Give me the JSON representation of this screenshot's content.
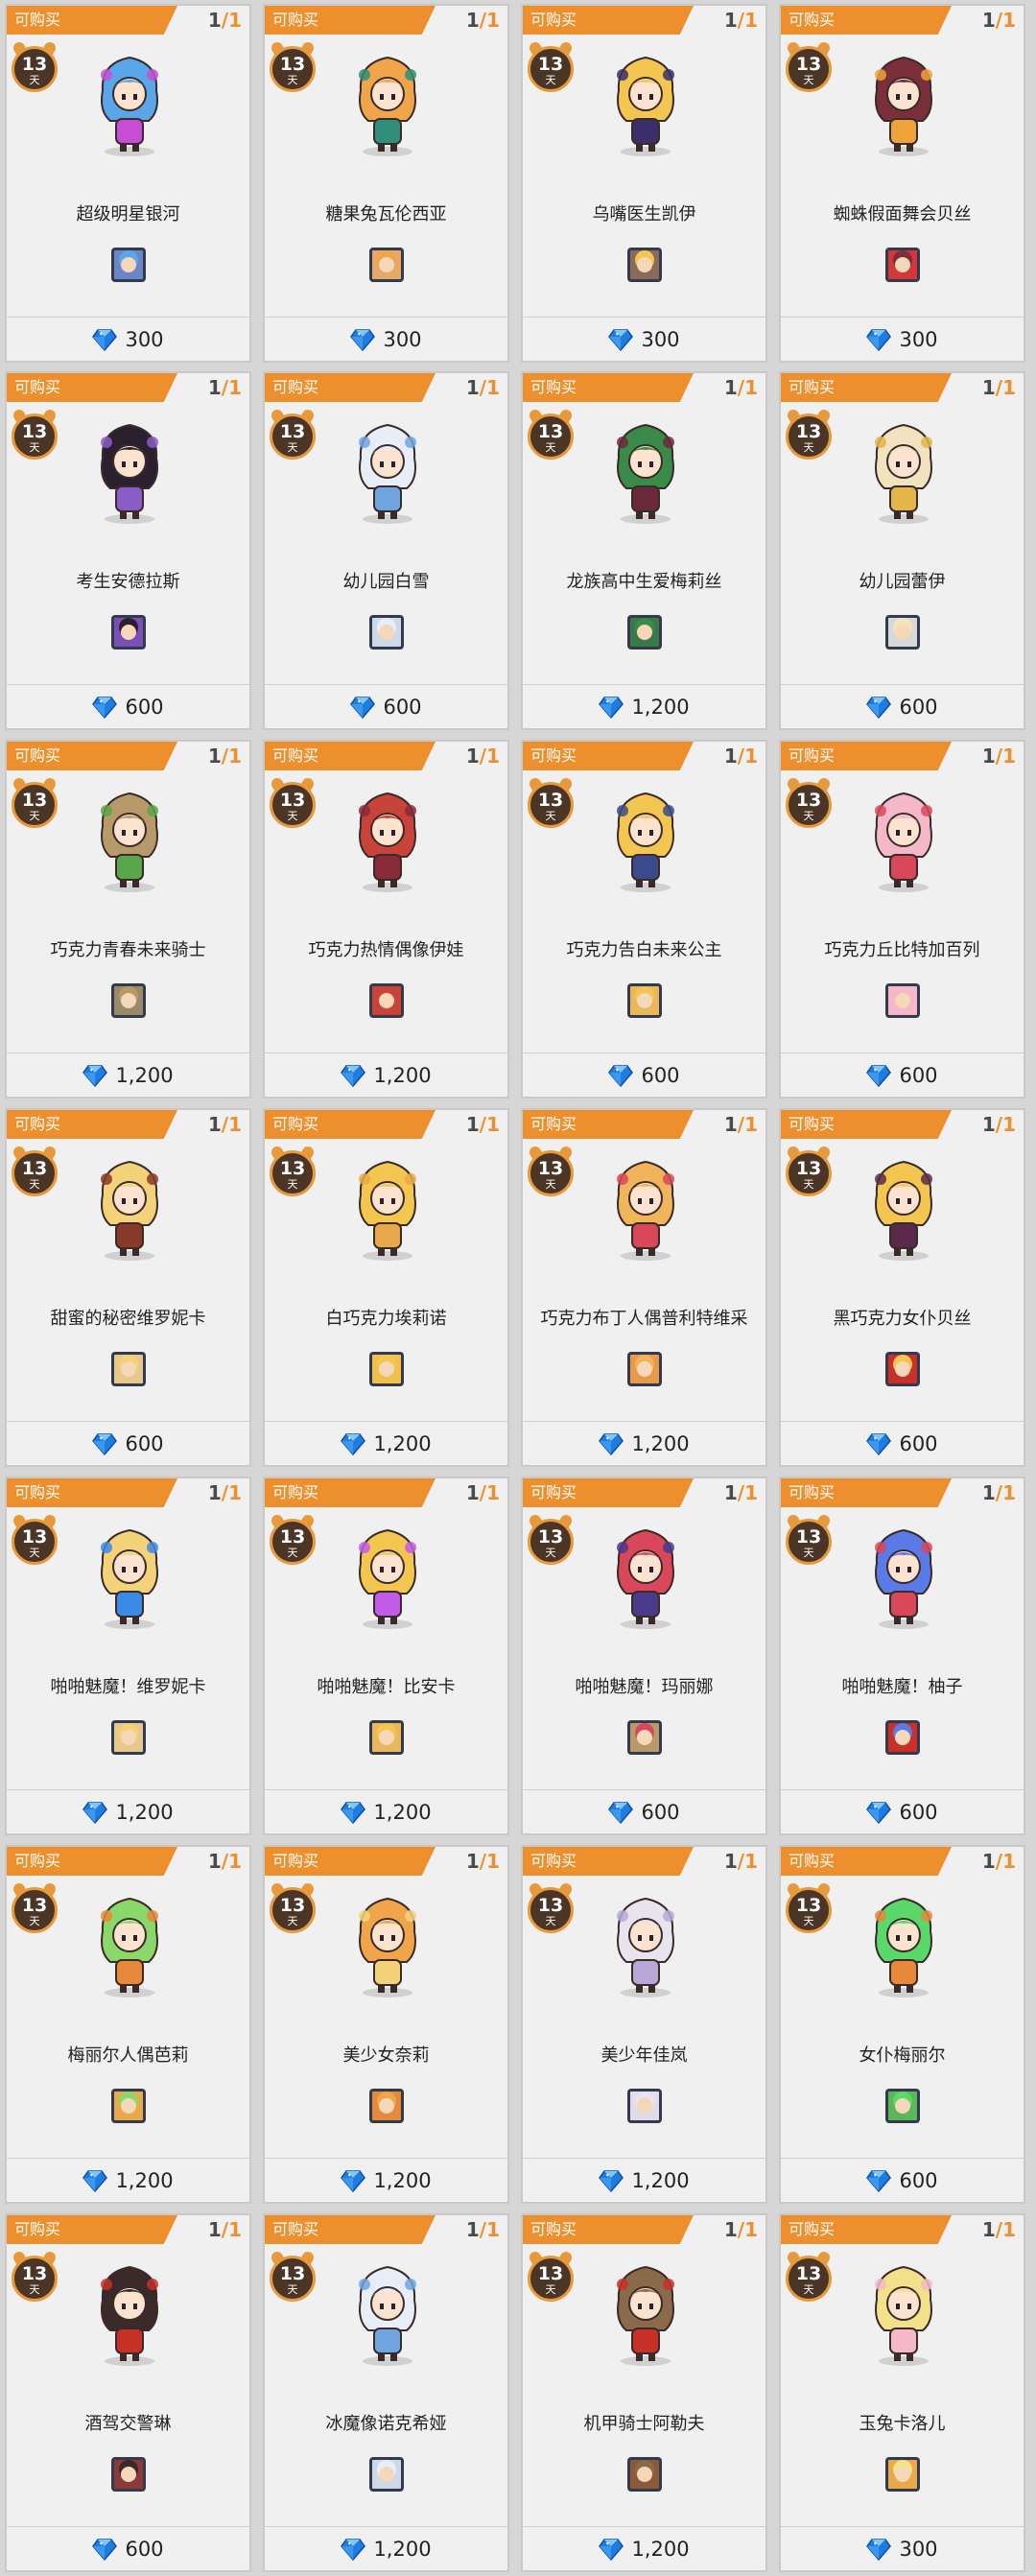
{
  "card_labels": {
    "status": "可购买",
    "count_current": "1",
    "count_slash": "/",
    "count_max": "1",
    "days": "13",
    "days_unit": "天"
  },
  "items": [
    {
      "name": "超级明星银河",
      "price": "300",
      "hair": "#5aa6e8",
      "accent": "#c74dd6",
      "thumb_bg": "#6b85c9"
    },
    {
      "name": "糖果兔瓦伦西亚",
      "price": "300",
      "hair": "#f0a54a",
      "accent": "#2f8f7a",
      "thumb_bg": "#e8a968"
    },
    {
      "name": "乌嘴医生凯伊",
      "price": "300",
      "hair": "#f3c64f",
      "accent": "#3a2f6a",
      "thumb_bg": "#8a6a5a"
    },
    {
      "name": "蜘蛛假面舞会贝丝",
      "price": "300",
      "hair": "#7a2f3a",
      "accent": "#f0a23a",
      "thumb_bg": "#d4363a"
    },
    {
      "name": "考生安德拉斯",
      "price": "600",
      "hair": "#2a2030",
      "accent": "#8a5cc7",
      "thumb_bg": "#7a4fb8"
    },
    {
      "name": "幼儿园白雪",
      "price": "600",
      "hair": "#e8eef8",
      "accent": "#6fa4de",
      "thumb_bg": "#cfd8e6"
    },
    {
      "name": "龙族高中生爱梅莉丝",
      "price": "1,200",
      "hair": "#3a8a4a",
      "accent": "#6a2a3a",
      "thumb_bg": "#3a7a4a"
    },
    {
      "name": "幼儿园蕾伊",
      "price": "600",
      "hair": "#f2e3c0",
      "accent": "#e3b54a",
      "thumb_bg": "#d8d8d8"
    },
    {
      "name": "巧克力青春未来骑士",
      "price": "1,200",
      "hair": "#b89a6a",
      "accent": "#5aa64a",
      "thumb_bg": "#9a8a6a"
    },
    {
      "name": "巧克力热情偶像伊娃",
      "price": "1,200",
      "hair": "#c8433a",
      "accent": "#8a2a3a",
      "thumb_bg": "#c8433a"
    },
    {
      "name": "巧克力告白未来公主",
      "price": "600",
      "hair": "#f3c64f",
      "accent": "#3a4a8a",
      "thumb_bg": "#e8b85a"
    },
    {
      "name": "巧克力丘比特加百列",
      "price": "600",
      "hair": "#f4b8c8",
      "accent": "#d8485a",
      "thumb_bg": "#f4b8c8"
    },
    {
      "name": "甜蜜的秘密维罗妮卡",
      "price": "600",
      "hair": "#f3d27a",
      "accent": "#8a3a2a",
      "thumb_bg": "#e8c88a"
    },
    {
      "name": "白巧克力埃莉诺",
      "price": "1,200",
      "hair": "#f3c64f",
      "accent": "#e8a94a",
      "thumb_bg": "#f0c04a"
    },
    {
      "name": "巧克力布丁人偶普利特维采",
      "price": "1,200",
      "hair": "#f0b45a",
      "accent": "#d8485a",
      "thumb_bg": "#e89a4a"
    },
    {
      "name": "黑巧克力女仆贝丝",
      "price": "600",
      "hair": "#f3c64f",
      "accent": "#5a2a4a",
      "thumb_bg": "#c8302a"
    },
    {
      "name": "啪啪魅魔！维罗妮卡",
      "price": "1,200",
      "hair": "#f3d27a",
      "accent": "#3a8ae8",
      "thumb_bg": "#e8c88a"
    },
    {
      "name": "啪啪魅魔！比安卡",
      "price": "1,200",
      "hair": "#f3c64f",
      "accent": "#c45ae8",
      "thumb_bg": "#e8b85a"
    },
    {
      "name": "啪啪魅魔！玛丽娜",
      "price": "600",
      "hair": "#d8485a",
      "accent": "#4a3a8a",
      "thumb_bg": "#b89a6a"
    },
    {
      "name": "啪啪魅魔！柚子",
      "price": "600",
      "hair": "#5a7ae8",
      "accent": "#d8485a",
      "thumb_bg": "#c8302a"
    },
    {
      "name": "梅丽尔人偶芭莉",
      "price": "1,200",
      "hair": "#8ad86a",
      "accent": "#e8883a",
      "thumb_bg": "#e8a94a"
    },
    {
      "name": "美少女奈莉",
      "price": "1,200",
      "hair": "#f0a54a",
      "accent": "#f3d27a",
      "thumb_bg": "#e8883a"
    },
    {
      "name": "美少年佳岚",
      "price": "1,200",
      "hair": "#e8e4ee",
      "accent": "#b8a8d8",
      "thumb_bg": "#e0dce8"
    },
    {
      "name": "女仆梅丽尔",
      "price": "600",
      "hair": "#5ad86a",
      "accent": "#e8883a",
      "thumb_bg": "#5ab85a"
    },
    {
      "name": "酒驾交警琳",
      "price": "600",
      "hair": "#3a2a2a",
      "accent": "#c8302a",
      "thumb_bg": "#8a3a3a"
    },
    {
      "name": "冰魔像诺克希娅",
      "price": "1,200",
      "hair": "#e8eef8",
      "accent": "#6fa4de",
      "thumb_bg": "#cfd8e6"
    },
    {
      "name": "机甲骑士阿勒夫",
      "price": "1,200",
      "hair": "#8a6a4a",
      "accent": "#c8302a",
      "thumb_bg": "#8a5a3a"
    },
    {
      "name": "玉兔卡洛儿",
      "price": "300",
      "hair": "#f3e08a",
      "accent": "#f4b8c8",
      "thumb_bg": "#e8a94a"
    }
  ]
}
